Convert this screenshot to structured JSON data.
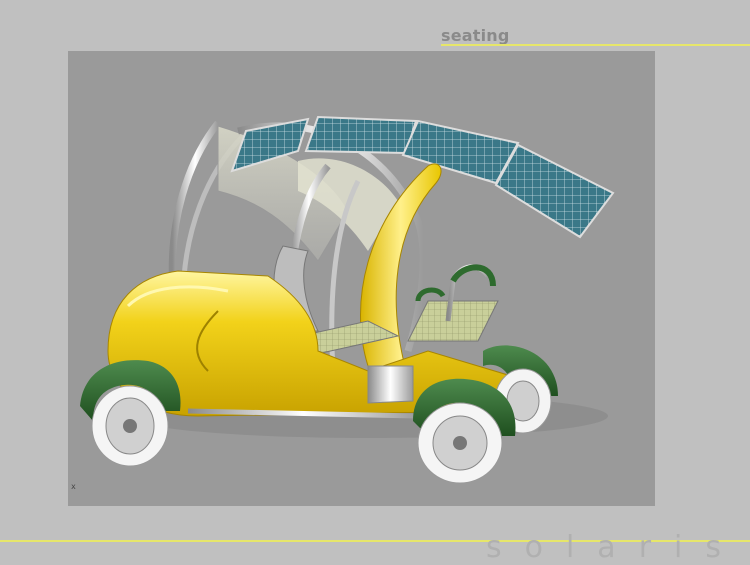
{
  "slide": {
    "title": "seating",
    "brand": "solaris"
  },
  "viewport": {
    "axis_marker": "x"
  },
  "colors": {
    "background": "#c0c0c0",
    "viewport": "#9a9a9a",
    "accent_line": "#e6e66a",
    "body_yellow": "#f2d21a",
    "fender_green": "#2e6b2e",
    "solar_panel": "#3f7f8f"
  }
}
